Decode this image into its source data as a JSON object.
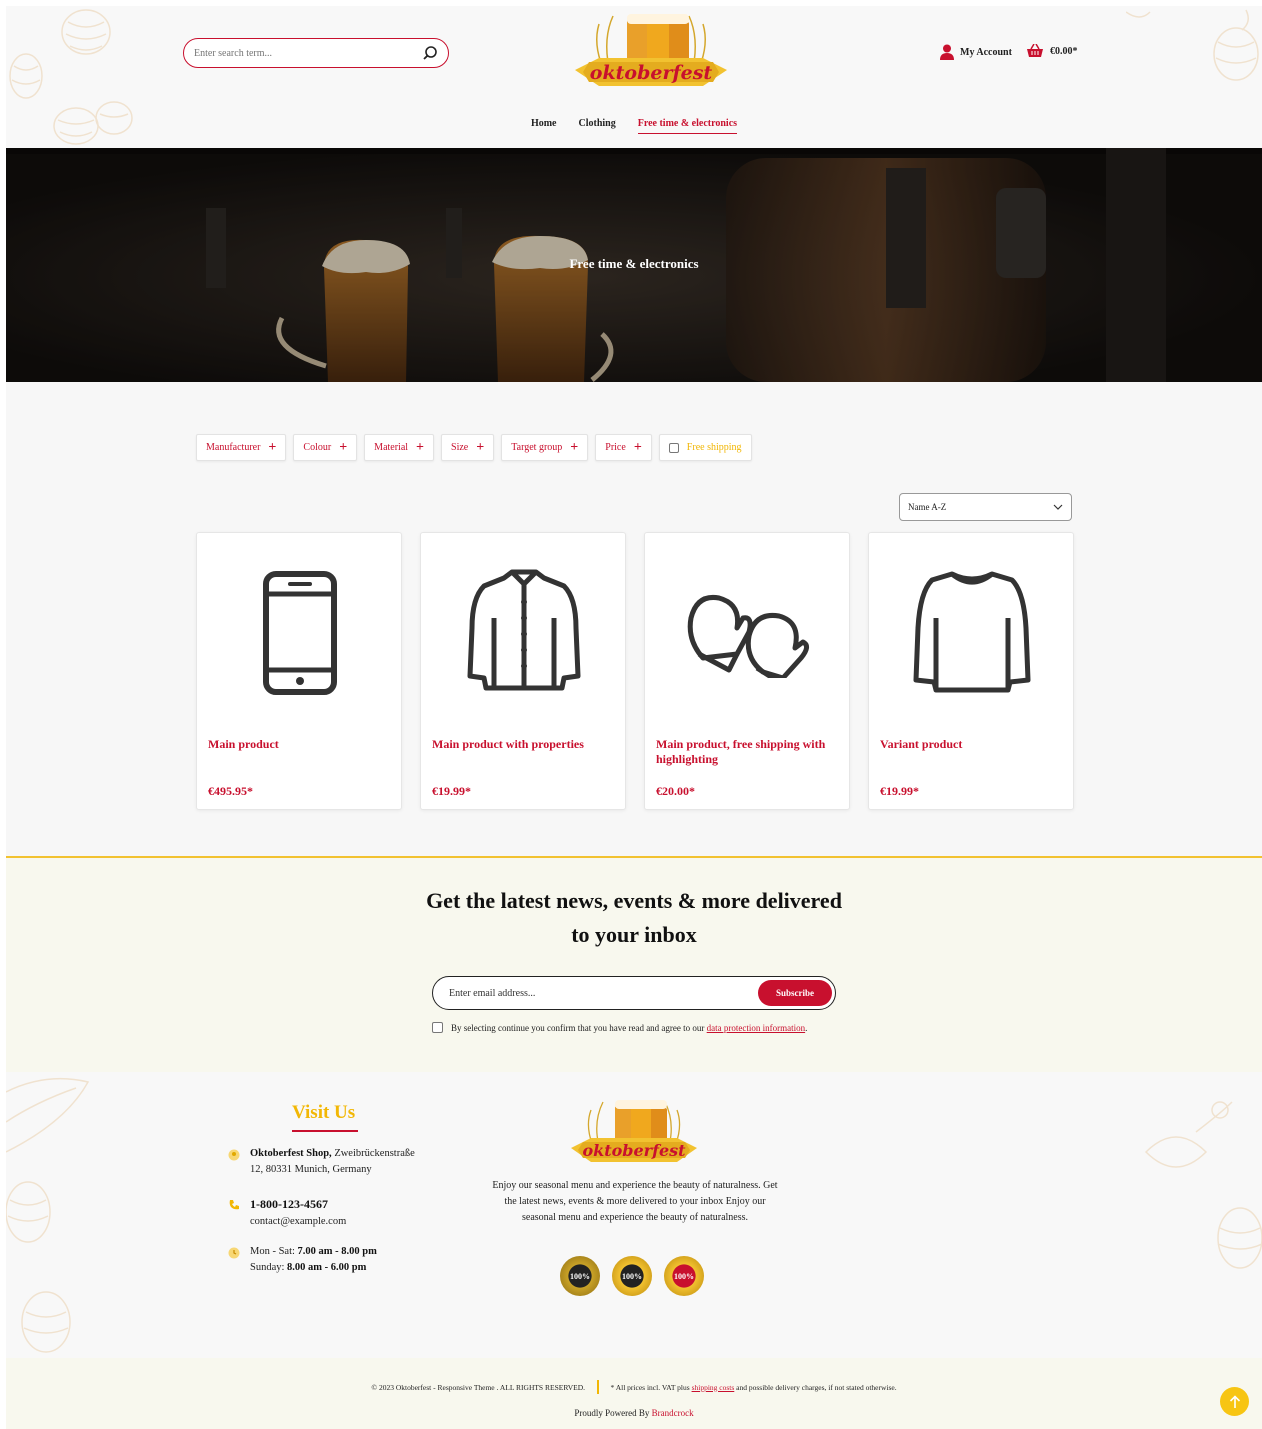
{
  "header": {
    "search_placeholder": "Enter search term...",
    "logo_text": "oktoberfest",
    "account_label": "My Account",
    "cart_total": "€0.00*"
  },
  "nav": {
    "items": [
      {
        "label": "Home",
        "active": false
      },
      {
        "label": "Clothing",
        "active": false
      },
      {
        "label": "Free time & electronics",
        "active": true
      }
    ]
  },
  "hero": {
    "title": "Free time & electronics"
  },
  "filters": {
    "items": [
      "Manufacturer",
      "Colour",
      "Material",
      "Size",
      "Target group",
      "Price"
    ],
    "free_shipping_label": "Free shipping",
    "sort_value": "Name A-Z"
  },
  "products": [
    {
      "name": "Main product",
      "price": "€495.95*",
      "icon": "smartphone-icon"
    },
    {
      "name": "Main product with properties",
      "price": "€19.99*",
      "icon": "jacket-icon"
    },
    {
      "name": "Main product, free shipping with highlighting",
      "price": "€20.00*",
      "icon": "mittens-icon"
    },
    {
      "name": "Variant product",
      "price": "€19.99*",
      "icon": "sweater-icon"
    }
  ],
  "newsletter": {
    "heading_line1": "Get the latest news, events & more delivered",
    "heading_line2": "to your inbox",
    "email_placeholder": "Enter email address...",
    "subscribe_label": "Subscribe",
    "consent_text": "By selecting continue you confirm that you have read and agree to our",
    "consent_link": "data protection information",
    "consent_end": "."
  },
  "footer": {
    "visit_title": "Visit Us",
    "address_bold": "Oktoberfest Shop,",
    "address_rest": " Zweibrückenstraße",
    "address_line2": "12, 80331 Munich, Germany",
    "phone": "1-800-123-4567",
    "email": "contact@example.com",
    "hours_weekday_prefix": "Mon - Sat: ",
    "hours_weekday": "7.00 am - 8.00 pm",
    "hours_sunday_prefix": "Sunday: ",
    "hours_sunday": "8.00 am - 6.00 pm",
    "logo_text": "oktoberfest",
    "description": "Enjoy our seasonal menu and experience the beauty of naturalness. Get the latest news, events & more delivered to your inbox Enjoy our seasonal menu and experience the beauty of naturalness.",
    "badges": [
      "100%",
      "100%",
      "100%"
    ]
  },
  "bottom": {
    "copyright": "© 2023 Oktoberfest - Responsive Theme . ALL RIGHTS RESERVED.",
    "vat_text": "* All prices incl. VAT plus",
    "vat_link": "shipping costs",
    "vat_end": "and possible delivery charges, if not stated otherwise.",
    "powered_prefix": "Proudly Powered By ",
    "powered_brand": "Brandcrock"
  },
  "colors": {
    "accent_red": "#c8102e",
    "accent_gold": "#f2b705",
    "newsletter_bg": "#f8f8ee"
  }
}
